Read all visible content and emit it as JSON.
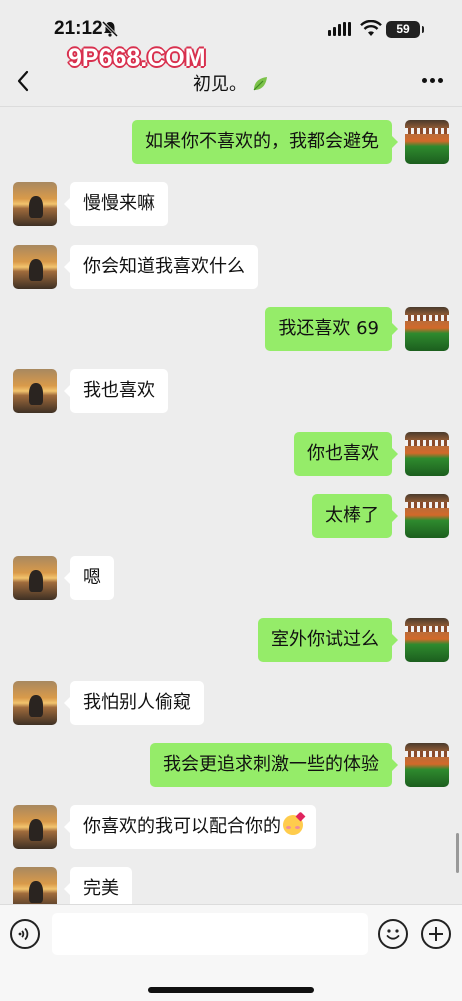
{
  "status_bar": {
    "time": "21:12",
    "battery": "59",
    "icons": [
      "bell-muted-icon",
      "signal-icon",
      "wifi-icon",
      "battery-icon"
    ]
  },
  "watermark": "9P668.COM",
  "nav": {
    "title": "初见。",
    "icons": [
      "back-chevron-icon",
      "leaf-icon",
      "more-dots-icon"
    ]
  },
  "messages": [
    {
      "side": "right",
      "text": "如果你不喜欢的，我都会避免"
    },
    {
      "side": "left",
      "text": "慢慢来嘛"
    },
    {
      "side": "left",
      "text": "你会知道我喜欢什么"
    },
    {
      "side": "right",
      "text": "我还喜欢 69"
    },
    {
      "side": "left",
      "text": "我也喜欢"
    },
    {
      "side": "right",
      "text": "你也喜欢"
    },
    {
      "side": "right",
      "text": "太棒了"
    },
    {
      "side": "left",
      "text": "嗯"
    },
    {
      "side": "right",
      "text": "室外你试过么"
    },
    {
      "side": "left",
      "text": "我怕别人偷窥"
    },
    {
      "side": "right",
      "text": "我会更追求刺激一些的体验"
    },
    {
      "side": "left",
      "text": "你喜欢的我可以配合你的",
      "emoji": "smiling-face-with-hearts"
    },
    {
      "side": "left",
      "text": "完美"
    }
  ],
  "input_bar": {
    "value": "",
    "icons": [
      "voice-icon",
      "emoji-icon",
      "plus-icon"
    ]
  },
  "colors": {
    "background": "#ededed",
    "sent_bubble": "#95ec69",
    "received_bubble": "#ffffff",
    "watermark_outline": "#d8304e"
  }
}
